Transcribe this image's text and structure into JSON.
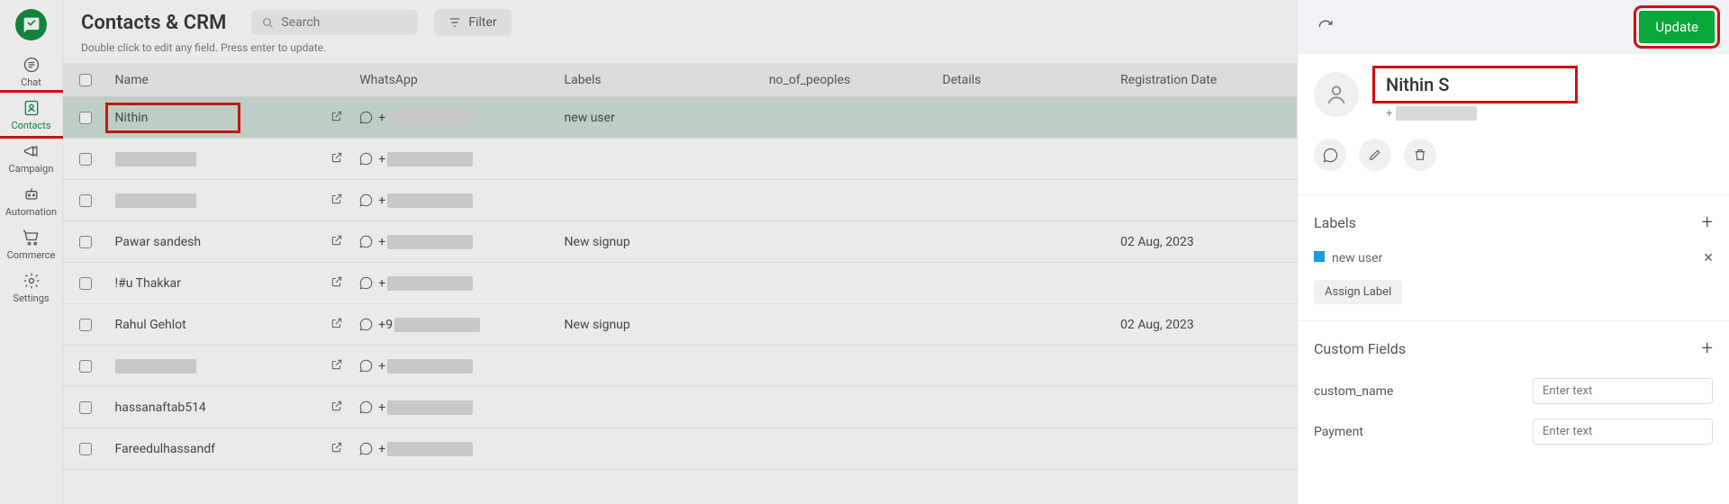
{
  "sidebar": {
    "items": [
      {
        "label": "Chat",
        "icon": "chat-icon"
      },
      {
        "label": "Contacts",
        "icon": "contacts-icon",
        "active": true
      },
      {
        "label": "Campaign",
        "icon": "megaphone-icon"
      },
      {
        "label": "Automation",
        "icon": "robot-icon"
      },
      {
        "label": "Commerce",
        "icon": "cart-icon"
      },
      {
        "label": "Settings",
        "icon": "gear-icon"
      }
    ]
  },
  "header": {
    "title": "Contacts & CRM",
    "search_placeholder": "Search",
    "filter_label": "Filter",
    "subhint": "Double click to edit any field. Press enter to update."
  },
  "columns": {
    "name": "Name",
    "whatsapp": "WhatsApp",
    "labels": "Labels",
    "no_of_peoples": "no_of_peoples",
    "details": "Details",
    "registration_date": "Registration Date"
  },
  "rows": [
    {
      "name": "Nithin",
      "whatsapp_prefix": "+",
      "labels": "new user",
      "reg": "",
      "selected": true,
      "highlighted": true,
      "redact_name": false
    },
    {
      "name": "",
      "whatsapp_prefix": "+",
      "labels": "",
      "reg": "",
      "redact_name": true
    },
    {
      "name": "",
      "whatsapp_prefix": "+",
      "labels": "",
      "reg": "",
      "redact_name": true
    },
    {
      "name": "Pawar sandesh",
      "whatsapp_prefix": "+",
      "labels": "New signup",
      "reg": "02 Aug, 2023",
      "redact_name": false
    },
    {
      "name": "!#u Thakkar",
      "whatsapp_prefix": "+",
      "labels": "",
      "reg": "",
      "redact_name": false
    },
    {
      "name": "Rahul Gehlot",
      "whatsapp_prefix": "+9",
      "labels": "New signup",
      "reg": "02 Aug, 2023",
      "redact_name": false
    },
    {
      "name": "",
      "whatsapp_prefix": "+",
      "labels": "",
      "reg": "",
      "redact_name": true
    },
    {
      "name": "hassanaftab514",
      "whatsapp_prefix": "+",
      "labels": "",
      "reg": "",
      "redact_name": false
    },
    {
      "name": "Fareedulhassandf",
      "whatsapp_prefix": "+",
      "labels": "",
      "reg": "",
      "redact_name": false
    }
  ],
  "panel": {
    "update_label": "Update",
    "name": "Nithin S",
    "sub_prefix": "+",
    "labels_title": "Labels",
    "label_item": "new user",
    "assign_label": "Assign Label",
    "custom_fields_title": "Custom Fields",
    "cf1_label": "custom_name",
    "cf2_label": "Payment",
    "cf_placeholder": "Enter text"
  }
}
